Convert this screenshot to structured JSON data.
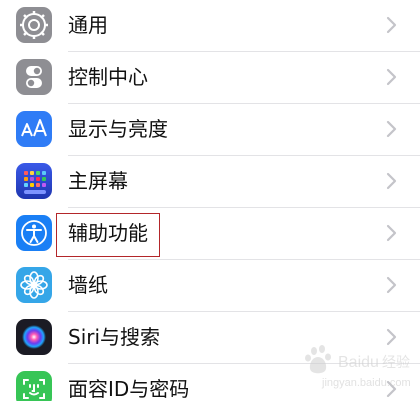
{
  "settings_list": {
    "items": [
      {
        "label": "通用",
        "icon": "gear-icon",
        "icon_bg": "#8e8e93"
      },
      {
        "label": "控制中心",
        "icon": "toggles-icon",
        "icon_bg": "#8e8e93"
      },
      {
        "label": "显示与亮度",
        "icon": "text-size-aa-icon",
        "icon_bg": "#2f7cf6"
      },
      {
        "label": "主屏幕",
        "icon": "home-screen-grid-icon",
        "icon_bg": "#2a4fd6"
      },
      {
        "label": "辅助功能",
        "icon": "accessibility-person-icon",
        "icon_bg": "#1a7ff5"
      },
      {
        "label": "墙纸",
        "icon": "flower-icon",
        "icon_bg": "#35a6e8"
      },
      {
        "label": "Siri与搜索",
        "icon": "siri-orb-icon",
        "icon_bg": "#1b1b24"
      },
      {
        "label": "面容ID与密码",
        "icon": "face-id-icon",
        "icon_bg": "#37c556"
      }
    ],
    "highlighted_item": "辅助功能",
    "highlight_color": "#b3262a"
  },
  "watermark": {
    "logo_text": "Baidu经验",
    "url": "jingyan.baidu.com"
  }
}
